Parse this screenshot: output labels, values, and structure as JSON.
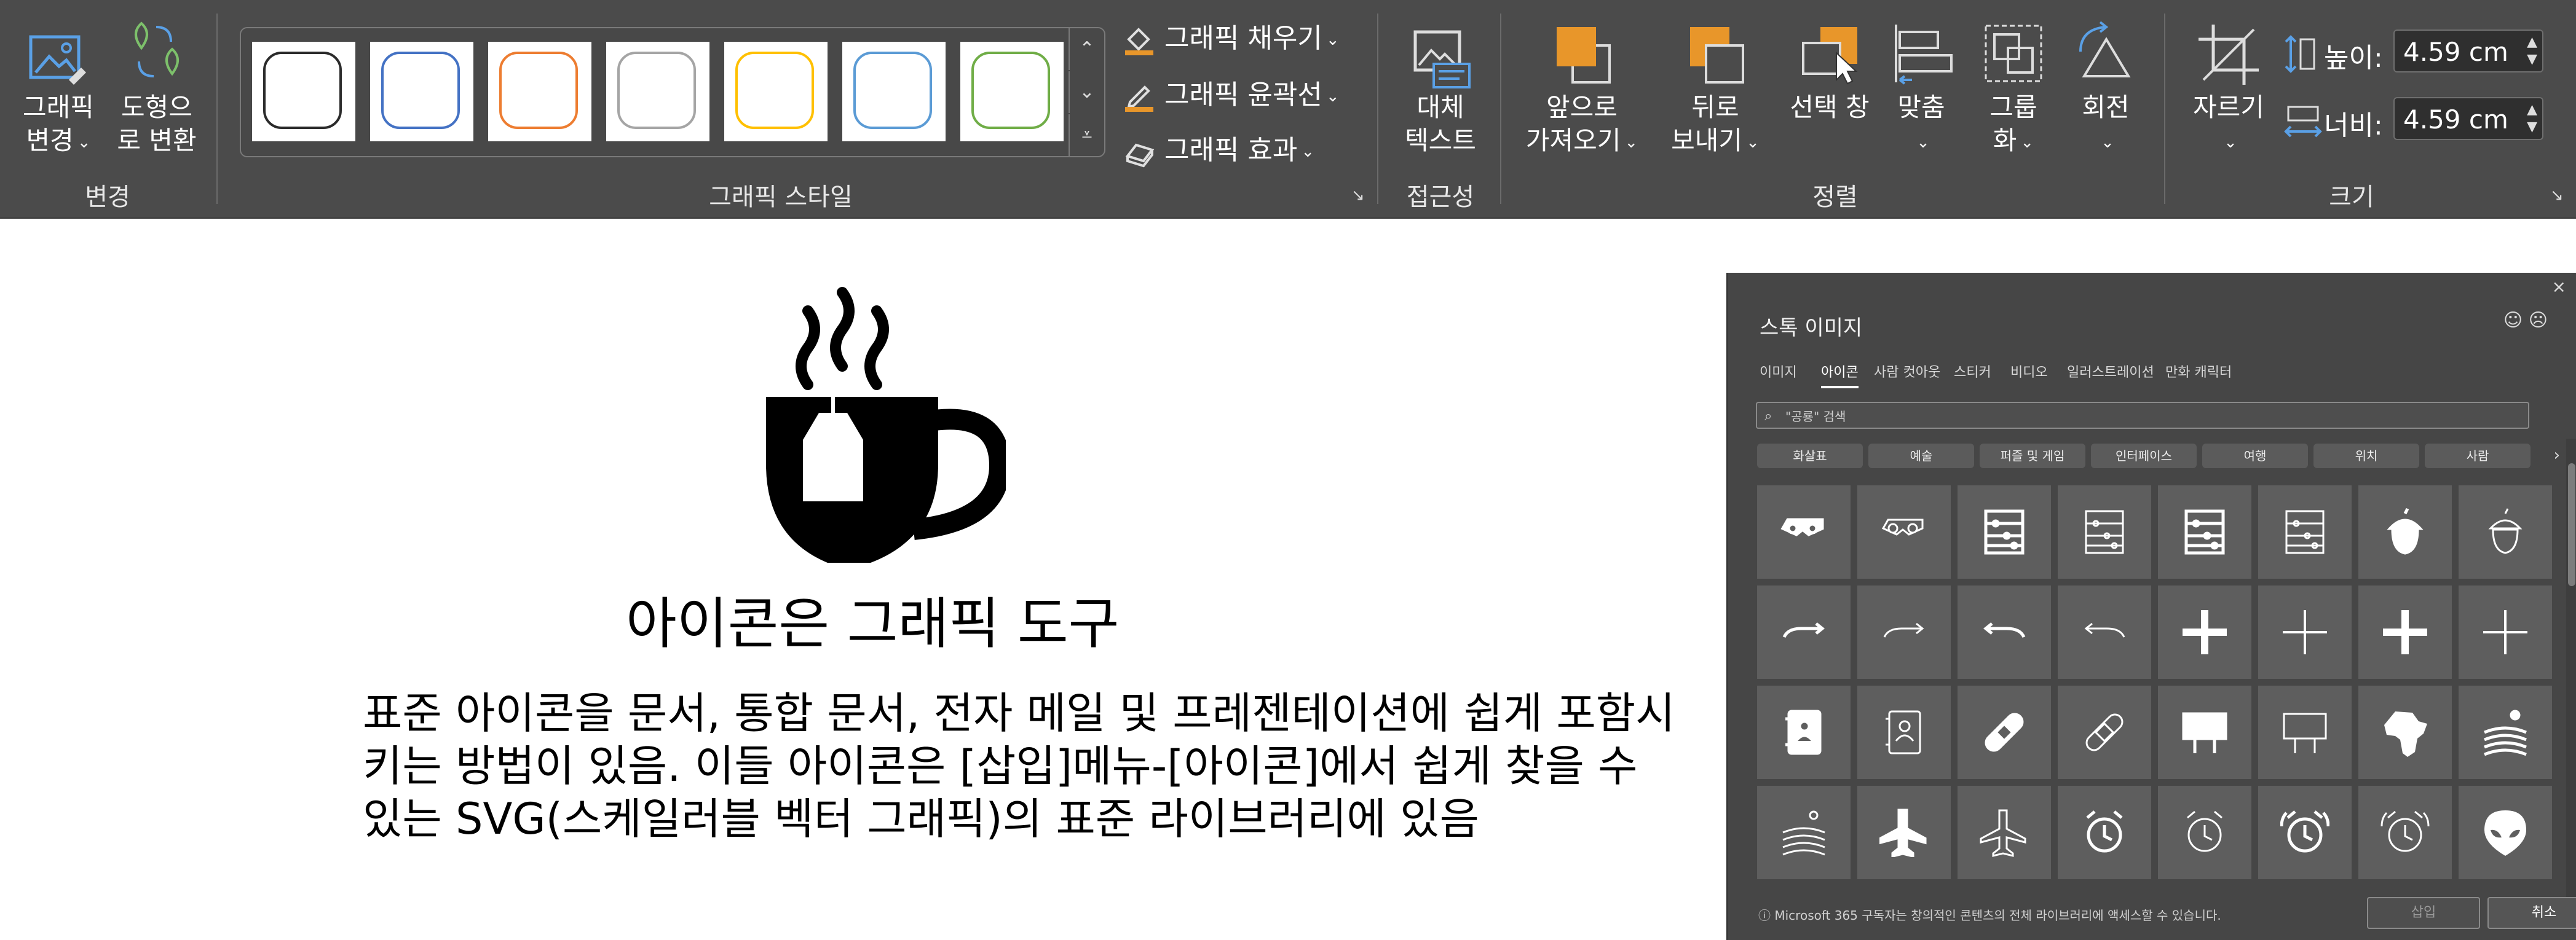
{
  "ribbon": {
    "change_group": {
      "label": "변경",
      "graphic_change": {
        "line1": "그래픽",
        "line2": "변경"
      },
      "convert_shape": {
        "line1": "도형으",
        "line2": "로 변환"
      }
    },
    "graphic_styles": {
      "label": "그래픽 스타일",
      "swatches": [
        {
          "color": "#2b2b2b"
        },
        {
          "color": "#4472c4"
        },
        {
          "color": "#ed7d31"
        },
        {
          "color": "#a5a5a5"
        },
        {
          "color": "#ffc000"
        },
        {
          "color": "#5b9bd5"
        },
        {
          "color": "#70ad47"
        }
      ],
      "fill": "그래픽 채우기",
      "outline": "그래픽 윤곽선",
      "effect": "그래픽 효과"
    },
    "accessibility": {
      "label": "접근성",
      "alt_text": {
        "line1": "대체",
        "line2": "텍스트"
      }
    },
    "arrange": {
      "label": "정렬",
      "bring_forward": {
        "line1": "앞으로",
        "line2": "가져오기"
      },
      "send_backward": {
        "line1": "뒤로",
        "line2": "보내기"
      },
      "selection_pane": {
        "line1": "선택 창"
      },
      "align": {
        "line1": "맞춤"
      },
      "group": {
        "line1": "그룹",
        "line2": "화"
      },
      "rotate": {
        "line1": "회전"
      }
    },
    "size": {
      "label": "크기",
      "crop": "자르기",
      "height_label": "높이:",
      "height_value": "4.59 cm",
      "width_label": "너비:",
      "width_value": "4.59 cm"
    },
    "accent_orange": "#e8962a"
  },
  "document": {
    "title": "아이콘은 그래픽 도구",
    "body_lines": [
      "표준 아이콘을 문서, 통합 문서, 전자 메일 및 프레젠테이션에 쉽게 포함시",
      "키는 방법이 있음. 이들 아이콘은 [삽입]메뉴-[아이콘]에서 쉽게 찾을 수",
      "있는 SVG(스케일러블 벡터 그래픽)의 표준 라이브러리에 있음"
    ],
    "image_icon": "hot-tea-cup-icon"
  },
  "stock_panel": {
    "title": "스톡 이미지",
    "close": "×",
    "tabs": [
      "이미지",
      "아이콘",
      "사람 컷아웃",
      "스티커",
      "비디오",
      "일러스트레이션",
      "만화 캐릭터"
    ],
    "active_tab": 1,
    "search_placeholder": "\"공룡\" 검색",
    "categories": [
      "화살표",
      "예술",
      "퍼즐 및 게임",
      "인터페이스",
      "여행",
      "위치",
      "사람"
    ],
    "icon_rows": [
      [
        "3d-glasses-filled",
        "3d-glasses-outline",
        "abacus-filled",
        "abacus-outline",
        "abacus-filled-2",
        "abacus-outline-2",
        "acorn-filled",
        "acorn-outline"
      ],
      [
        "arrow-right-turn-filled",
        "arrow-right-turn-outline",
        "arrow-left-turn-filled",
        "arrow-left-turn-outline",
        "add-filled",
        "add-outline",
        "address-book-filled",
        "address-book-outline"
      ],
      [
        "contact-card-filled",
        "contact-card-outline",
        "bandage-filled",
        "bandage-outline",
        "billboard-filled",
        "billboard-outline",
        "africa-map-filled",
        "farm-landscape-filled"
      ],
      [
        "farm-landscape-outline",
        "airplane-filled",
        "airplane-outline",
        "alarm-clock-filled",
        "alarm-clock-outline",
        "ringing-alarm-filled",
        "ringing-alarm-outline",
        "alien-face-filled"
      ]
    ],
    "footer": "Microsoft 365 구독자는 창의적인 콘텐츠의 전체 라이브러리에 액세스할 수 있습니다.",
    "insert": "삽입",
    "cancel": "취소"
  }
}
